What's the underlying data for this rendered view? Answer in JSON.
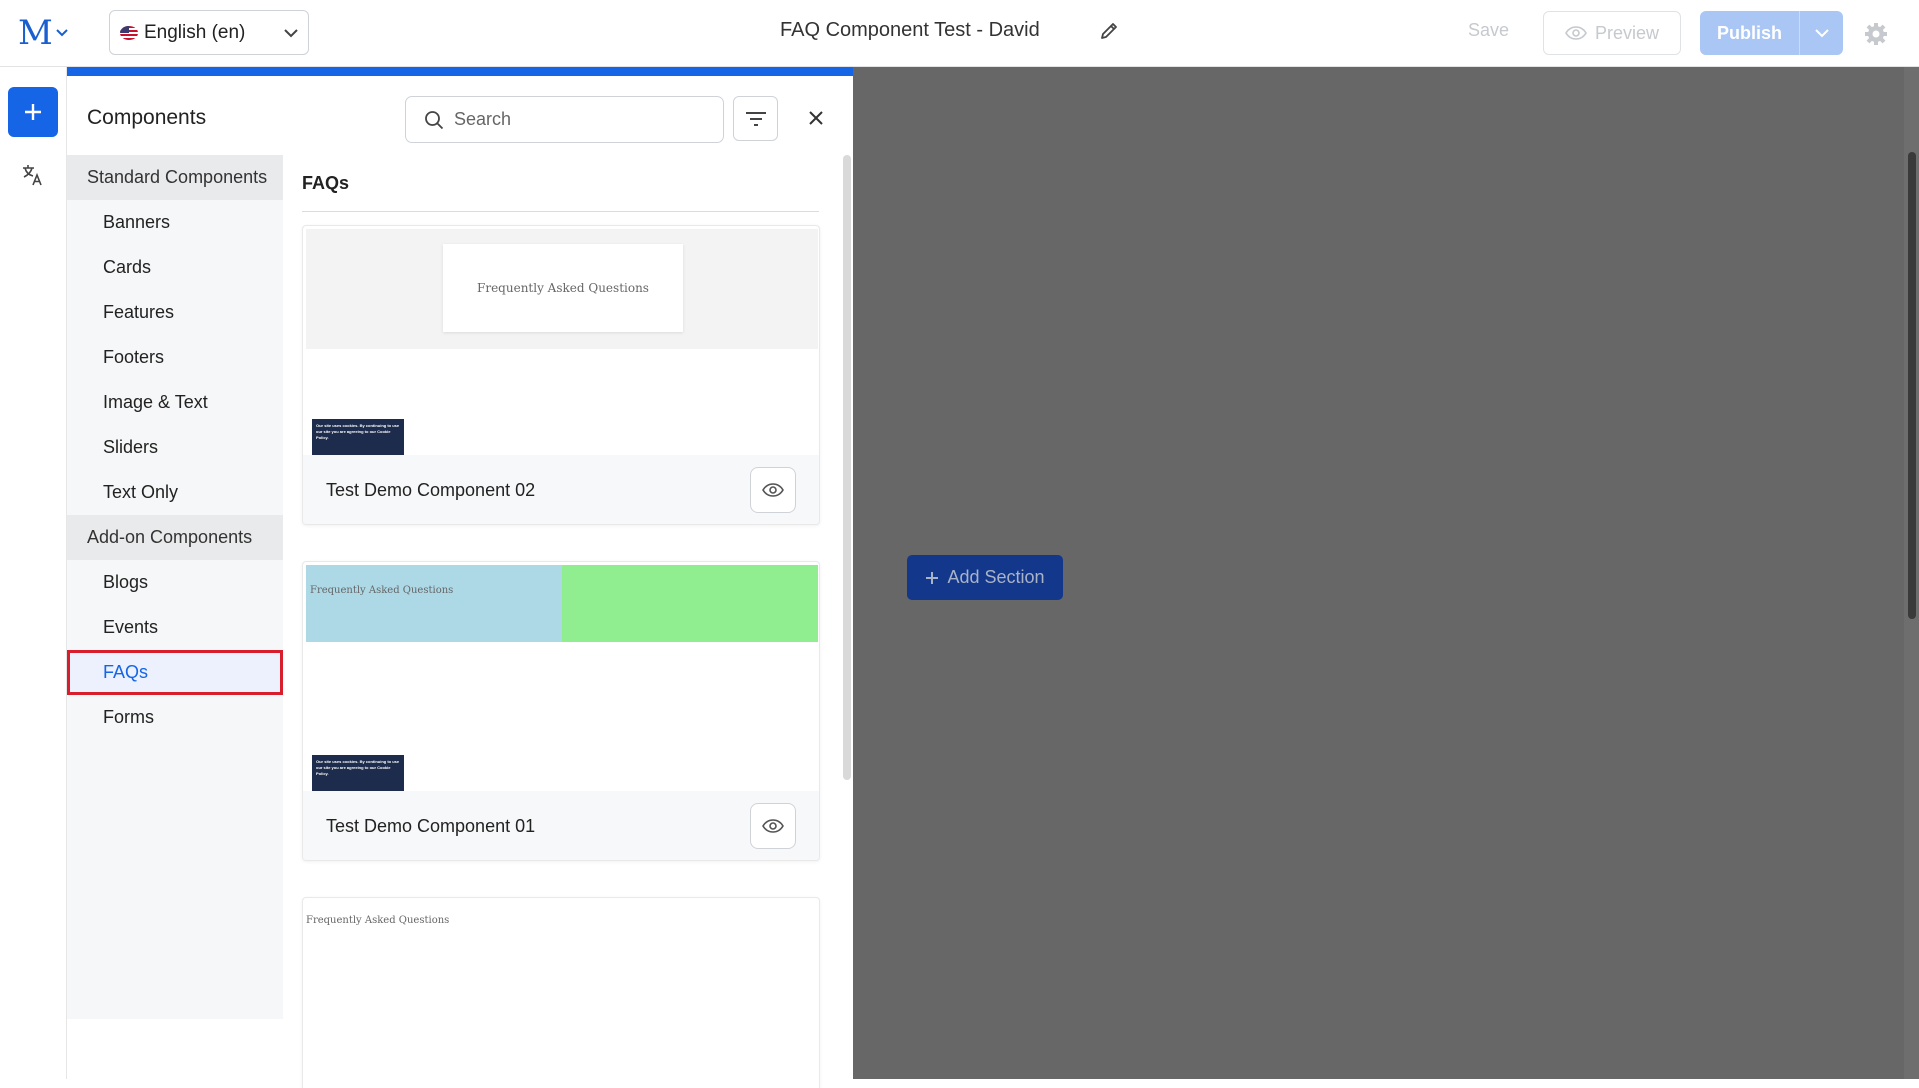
{
  "header": {
    "logo_letter": "M",
    "language": "English (en)",
    "page_title": "FAQ Component Test - David",
    "save_label": "Save",
    "preview_label": "Preview",
    "publish_label": "Publish"
  },
  "panel": {
    "title": "Components",
    "search_placeholder": "Search"
  },
  "categories": {
    "standard_header": "Standard Components",
    "standard": [
      "Banners",
      "Cards",
      "Features",
      "Footers",
      "Image & Text",
      "Sliders",
      "Text Only"
    ],
    "addon_header": "Add-on Components",
    "addon": [
      "Blogs",
      "Events",
      "FAQs",
      "Forms"
    ],
    "active": "FAQs"
  },
  "content": {
    "heading": "FAQs",
    "thumb_text": "Frequently Asked Questions",
    "cookie_text": "Our site uses cookies. By continuing to use our site you are agreeing to our Cookie Policy.",
    "cards": [
      {
        "name": "Test Demo Component 02"
      },
      {
        "name": "Test Demo Component 01"
      }
    ]
  },
  "canvas": {
    "add_section_label": "Add Section"
  },
  "colors": {
    "primary": "#1565e6",
    "highlight": "#d81e2c",
    "canvas_bg": "#676767"
  }
}
